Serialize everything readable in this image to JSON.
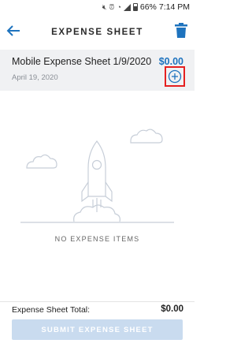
{
  "status_bar": {
    "battery_percent": "66%",
    "time": "7:14 PM",
    "icons": [
      "mute-icon",
      "alarm-icon",
      "wifi-icon",
      "signal-icon",
      "battery-icon"
    ]
  },
  "header": {
    "title": "EXPENSE SHEET",
    "back_icon": "arrow-left-icon",
    "delete_icon": "trash-icon"
  },
  "sheet": {
    "name": "Mobile Expense Sheet 1/9/2020",
    "amount": "$0.00",
    "date": "April 19, 2020",
    "add_icon": "plus-circle-icon"
  },
  "empty_state": {
    "label": "NO EXPENSE ITEMS",
    "illustration": "rocket-illustration"
  },
  "footer": {
    "total_label": "Expense Sheet Total:",
    "total_value": "$0.00",
    "submit_label": "SUBMIT EXPENSE SHEET"
  },
  "colors": {
    "accent": "#1e73be",
    "highlight_box": "#e52020",
    "sheet_bar_bg": "#f0f1f3",
    "submit_disabled_bg": "#c9dbef"
  }
}
